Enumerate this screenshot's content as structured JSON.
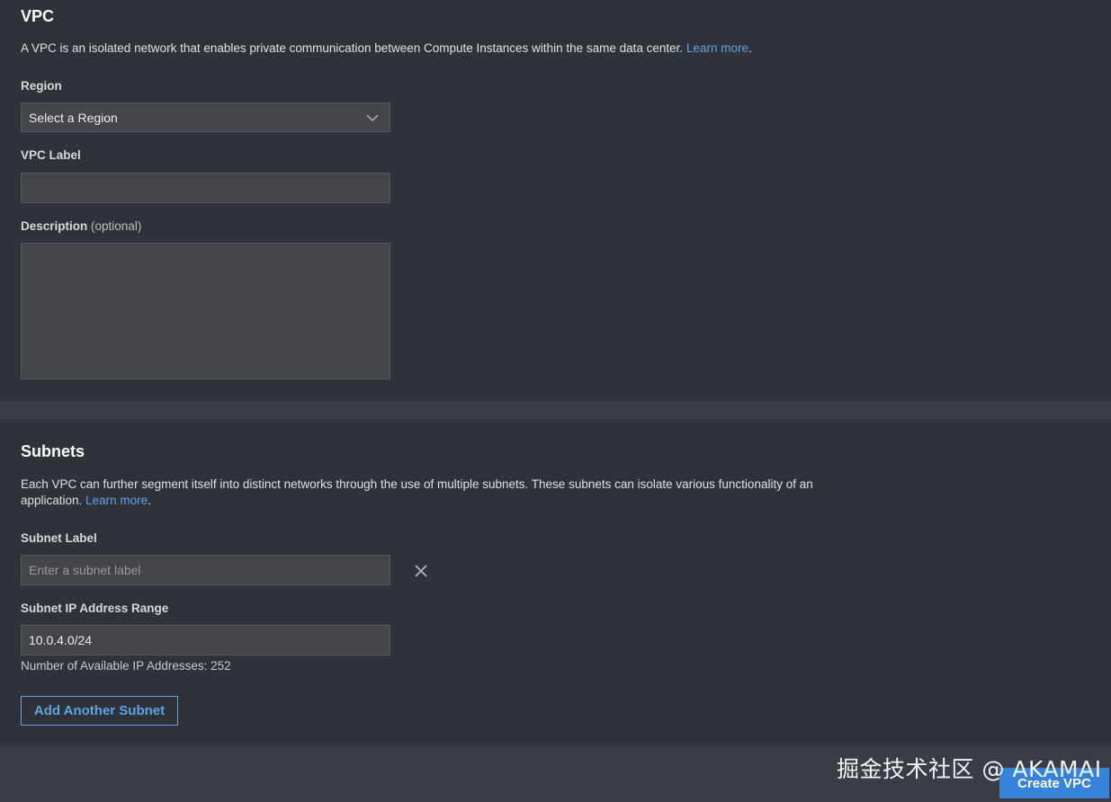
{
  "vpc_section": {
    "title": "VPC",
    "description": "A VPC is an isolated network that enables private communication between Compute Instances within the same data center.",
    "learn_more": "Learn more",
    "period": ".",
    "region": {
      "label": "Region",
      "selected": "Select a Region"
    },
    "vpc_label": {
      "label": "VPC Label",
      "value": ""
    },
    "description_field": {
      "label": "Description",
      "optional": "(optional)",
      "value": ""
    }
  },
  "subnets_section": {
    "title": "Subnets",
    "description": "Each VPC can further segment itself into distinct networks through the use of multiple subnets. These subnets can isolate various functionality of an application.",
    "learn_more": "Learn more",
    "period": ".",
    "subnet_label": {
      "label": "Subnet Label",
      "placeholder": "Enter a subnet label",
      "value": ""
    },
    "ip_range": {
      "label": "Subnet IP Address Range",
      "value": "10.0.4.0/24"
    },
    "available_ips": "Number of Available IP Addresses: 252",
    "add_button": "Add Another Subnet"
  },
  "footer": {
    "create_button": "Create VPC",
    "watermark": "掘金技术社区 @ AKAMAI"
  },
  "icons": {
    "dropdown": "chevron-down-icon",
    "remove": "close-icon"
  },
  "colors": {
    "background": "#3a3d45",
    "panel": "#2f3239",
    "field": "#434549",
    "link": "#5fa2e6",
    "primary_button": "#3683dc"
  }
}
